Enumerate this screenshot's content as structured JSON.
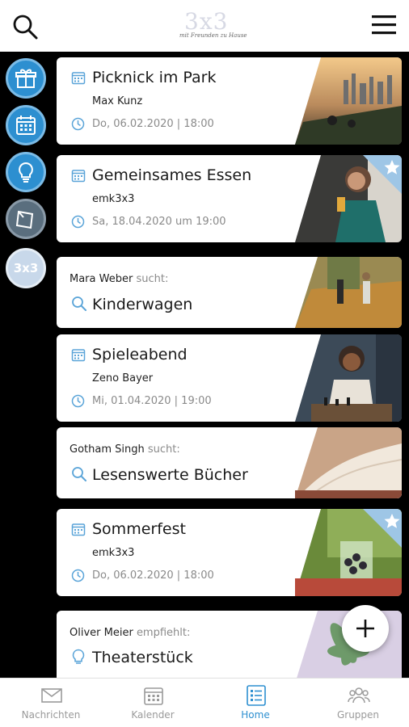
{
  "header": {
    "logo_big": "3x3",
    "logo_small": "mit Freunden zu Hause"
  },
  "colors": {
    "accent": "#2d8fd0",
    "meta_grey": "#8a8a8a",
    "background": "#000000"
  },
  "sidebar": {
    "items": [
      {
        "icon": "gift-icon"
      },
      {
        "icon": "calendar-icon"
      },
      {
        "icon": "lightbulb-icon"
      },
      {
        "icon": "note-icon"
      },
      {
        "label": "3x3"
      }
    ]
  },
  "feed": {
    "cards": [
      {
        "type": "event",
        "title": "Picknick im Park",
        "subtitle": "Max Kunz",
        "datetime": "Do, 06.02.2020 | 18:00",
        "favorite": false
      },
      {
        "type": "event",
        "title": "Gemeinsames Essen",
        "subtitle": "emk3x3",
        "datetime": "Sa, 18.04.2020 um 19:00",
        "favorite": true
      },
      {
        "type": "search",
        "name": "Mara Weber",
        "verb": "sucht:",
        "title": "Kinderwagen"
      },
      {
        "type": "event",
        "title": "Spieleabend",
        "subtitle": "Zeno Bayer",
        "datetime": "Mi, 01.04.2020 | 19:00",
        "favorite": false
      },
      {
        "type": "search",
        "name": "Gotham Singh",
        "verb": "sucht:",
        "title": "Lesenswerte Bücher"
      },
      {
        "type": "event",
        "title": "Sommerfest",
        "subtitle": "emk3x3",
        "datetime": "Do, 06.02.2020 | 18:00",
        "favorite": true
      },
      {
        "type": "recommend",
        "name": "Oliver Meier",
        "verb": "empfiehlt:",
        "title": "Theaterstück"
      }
    ]
  },
  "bottom_nav": {
    "tabs": [
      {
        "label": "Nachrichten",
        "icon": "mail-icon",
        "active": false
      },
      {
        "label": "Kalender",
        "icon": "calendar-icon",
        "active": false
      },
      {
        "label": "Home",
        "icon": "list-icon",
        "active": true
      },
      {
        "label": "Gruppen",
        "icon": "group-icon",
        "active": false
      }
    ]
  }
}
